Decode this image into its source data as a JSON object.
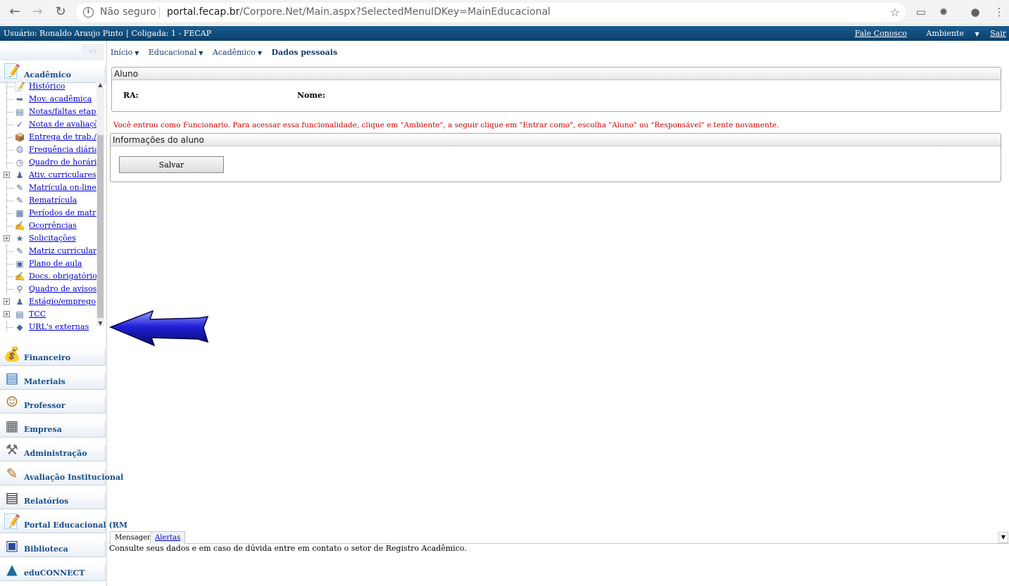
{
  "browser": {
    "security": "Não seguro",
    "url_host": "portal.fecap.br",
    "url_path": "/Corpore.Net/Main.aspx?SelectedMenuIDKey=MainEducacional"
  },
  "header": {
    "user": "Usuário: Ronaldo Araujo Pinto",
    "coligada": "Coligada: 1 - FECAP",
    "contact": "Fale Conosco",
    "environment": "Ambiente",
    "logout": "Sair"
  },
  "sidebar": {
    "collapse_glyph": "‹‹",
    "active_module": {
      "label": "Acadêmico",
      "icon": "academic-icon"
    },
    "tree_items": [
      {
        "label": "Histórico",
        "icon": "history-icon",
        "expandable": false
      },
      {
        "label": "Mov. acadêmica",
        "icon": "arrows-icon",
        "expandable": false
      },
      {
        "label": "Notas/faltas etapas",
        "icon": "table-icon",
        "expandable": false
      },
      {
        "label": "Notas de avaliações",
        "icon": "check-icon",
        "expandable": false
      },
      {
        "label": "Entrega de trab./aval",
        "icon": "delivery-icon",
        "expandable": false
      },
      {
        "label": "Frequência diária",
        "icon": "people-icon",
        "expandable": false
      },
      {
        "label": "Quadro de horários",
        "icon": "clock-icon",
        "expandable": false
      },
      {
        "label": "Ativ. curriculares",
        "icon": "person-icon",
        "expandable": true
      },
      {
        "label": "Matrícula on-line",
        "icon": "enroll-icon",
        "expandable": false
      },
      {
        "label": "Rematrícula",
        "icon": "reenroll-icon",
        "expandable": false
      },
      {
        "label": "Períodos de matrícul",
        "icon": "calendar-icon",
        "expandable": false
      },
      {
        "label": "Ocorrências",
        "icon": "pen-icon",
        "expandable": false
      },
      {
        "label": "Solicitações",
        "icon": "request-icon",
        "expandable": true
      },
      {
        "label": "Matriz curricular",
        "icon": "matrix-icon",
        "expandable": false
      },
      {
        "label": "Plano de aula",
        "icon": "book-icon",
        "expandable": false
      },
      {
        "label": "Docs. obrigatórios",
        "icon": "docs-icon",
        "expandable": false
      },
      {
        "label": "Quadro de avisos",
        "icon": "search-icon",
        "expandable": false
      },
      {
        "label": "Estágio/emprego",
        "icon": "intern-icon",
        "expandable": true
      },
      {
        "label": "TCC",
        "icon": "document-icon",
        "expandable": true
      },
      {
        "label": "URL's externas",
        "icon": "globe-icon",
        "expandable": false
      }
    ],
    "modules": [
      {
        "label": "Financeiro",
        "icon": "money-icon"
      },
      {
        "label": "Materiais",
        "icon": "materials-icon"
      },
      {
        "label": "Professor",
        "icon": "teacher-icon"
      },
      {
        "label": "Empresa",
        "icon": "building-icon"
      },
      {
        "label": "Administração",
        "icon": "wrench-icon"
      },
      {
        "label": "Avaliação Institucional",
        "icon": "evaluation-icon"
      },
      {
        "label": "Relatórios",
        "icon": "report-icon"
      },
      {
        "label": "Portal Educacional (RM",
        "icon": "portal-icon"
      },
      {
        "label": "Biblioteca",
        "icon": "library-icon"
      },
      {
        "label": "eduCONNECT",
        "icon": "graduation-cap-icon"
      }
    ]
  },
  "breadcrumb": {
    "items": [
      "Início",
      "Educacional",
      "Acadêmico"
    ],
    "current": "Dados pessoais"
  },
  "aluno_panel": {
    "title": "Aluno",
    "ra_label": "RA:",
    "nome_label": "Nome:"
  },
  "warning": "Você entrou como Funcionario. Para acessar essa funcionalidade, clique em \"Ambiente\", a seguir clique em \"Entrar como\", escolha \"Aluno\" ou \"Responsável\" e tente novamente.",
  "info_panel": {
    "title": "Informações do aluno",
    "save_label": "Salvar"
  },
  "messages": {
    "tabs": [
      "Mensagens",
      "Alertas"
    ],
    "text": "Consulte seus dados e em caso de dúvida entre em contato o setor de Registro Acadêmico."
  }
}
